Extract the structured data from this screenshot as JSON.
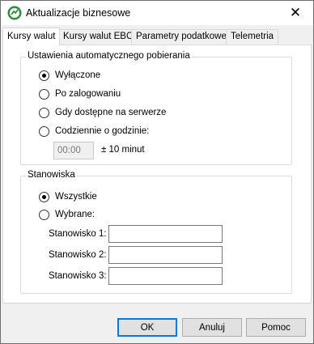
{
  "window": {
    "title": "Aktualizacje biznesowe",
    "close_glyph": "✕",
    "icon": "app-logo-icon",
    "accent": "#2e8b3a"
  },
  "tabs": [
    {
      "label": "Kursy walut",
      "active": true
    },
    {
      "label": "Kursy walut EBC",
      "active": false
    },
    {
      "label": "Parametry podatkowe",
      "active": false
    },
    {
      "label": "Telemetria",
      "active": false
    }
  ],
  "auto_fetch": {
    "legend": "Ustawienia automatycznego pobierania",
    "options": [
      {
        "label": "Wyłączone",
        "checked": true
      },
      {
        "label": "Po zalogowaniu",
        "checked": false
      },
      {
        "label": "Gdy dostępne na serwerze",
        "checked": false
      },
      {
        "label": "Codziennie o godzinie:",
        "checked": false
      }
    ],
    "time_value": "00:00",
    "time_note": "± 10 minut"
  },
  "workstations": {
    "legend": "Stanowiska",
    "options": [
      {
        "label": "Wszystkie",
        "checked": true
      },
      {
        "label": "Wybrane:",
        "checked": false
      }
    ],
    "fields": [
      {
        "label": "Stanowisko 1:",
        "value": ""
      },
      {
        "label": "Stanowisko 2:",
        "value": ""
      },
      {
        "label": "Stanowisko 3:",
        "value": ""
      }
    ]
  },
  "buttons": {
    "ok": "OK",
    "cancel": "Anuluj",
    "help": "Pomoc"
  }
}
